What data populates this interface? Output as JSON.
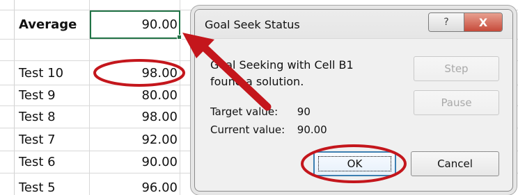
{
  "sheet": {
    "rows": [
      {
        "label": "Average",
        "value": "90.00",
        "bold": true
      },
      {
        "label": "",
        "value": "",
        "bold": false
      },
      {
        "label": "Test 10",
        "value": "98.00",
        "bold": false
      },
      {
        "label": "Test 9",
        "value": "80.00",
        "bold": false
      },
      {
        "label": "Test 8",
        "value": "98.00",
        "bold": false
      },
      {
        "label": "Test 7",
        "value": "92.00",
        "bold": false
      },
      {
        "label": "Test 6",
        "value": "90.00",
        "bold": false
      },
      {
        "label": "Test 5",
        "value": "96.00",
        "bold": false
      }
    ]
  },
  "dialog": {
    "title": "Goal Seek Status",
    "help_glyph": "?",
    "close_glyph": "X",
    "message_line1": "Goal Seeking with Cell B1",
    "message_line2": "found a solution.",
    "target_label": "Target value:",
    "target_value": "90",
    "current_label": "Current value:",
    "current_value": "90.00",
    "buttons": {
      "step": "Step",
      "pause": "Pause",
      "ok": "OK",
      "cancel": "Cancel"
    }
  },
  "annotation": {
    "color": "#c4161c"
  }
}
